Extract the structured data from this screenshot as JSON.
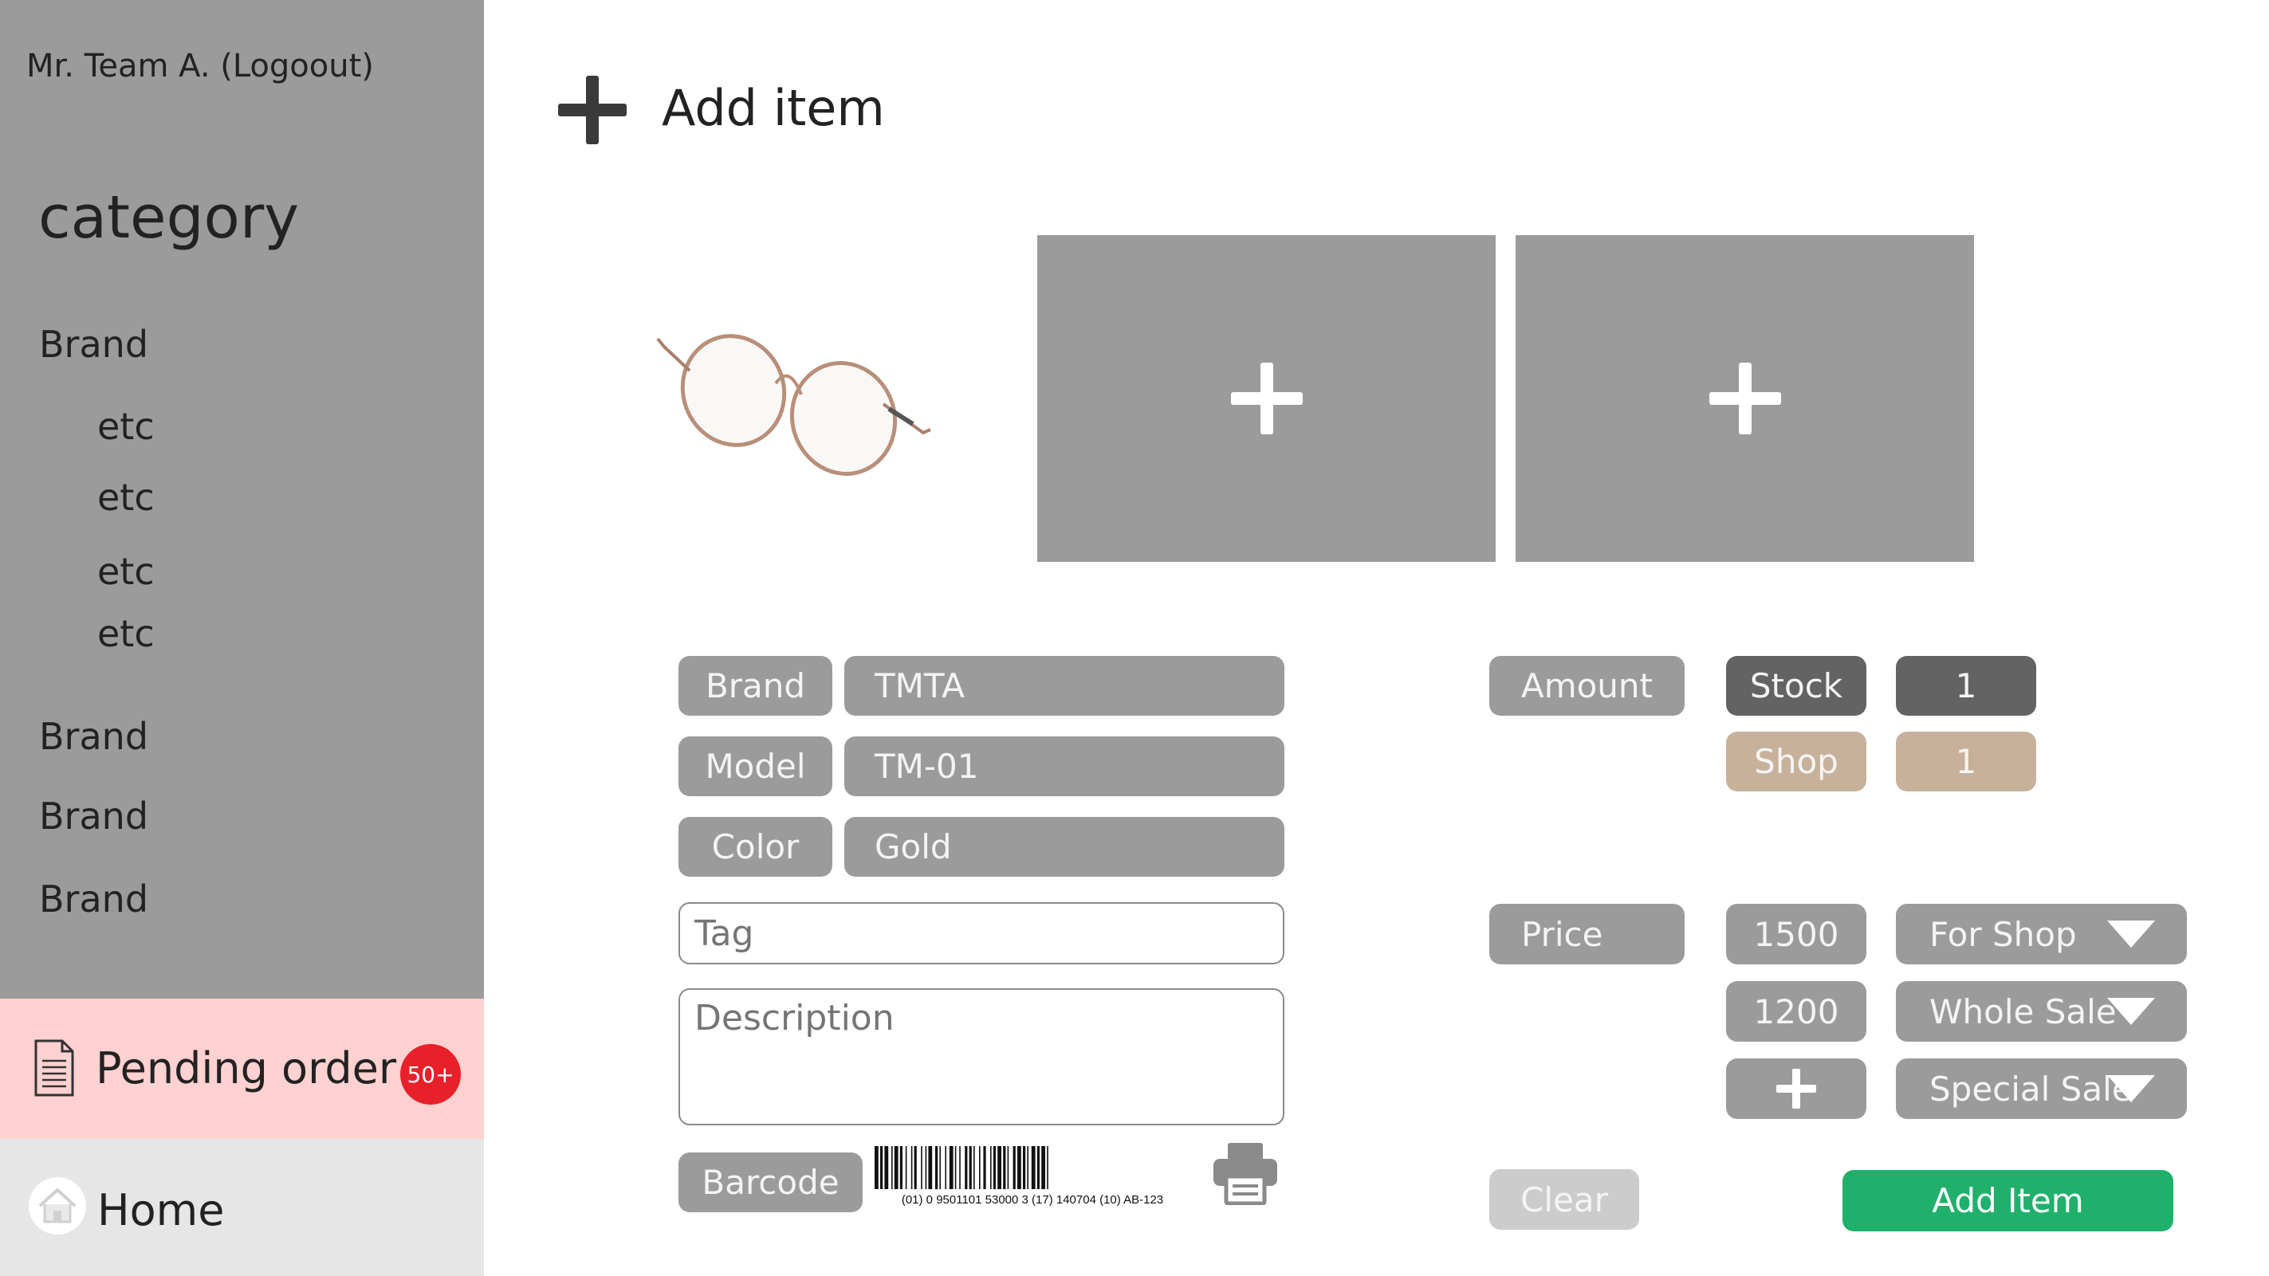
{
  "sidebar": {
    "user_line": "Mr. Team A. (Logoout)",
    "category_title": "category",
    "brand_1": "Brand",
    "sub_items": [
      "etc",
      "etc",
      "etc",
      "etc"
    ],
    "brand_2": "Brand",
    "brand_3": "Brand",
    "brand_4": "Brand",
    "pending": {
      "label": "Pending order",
      "badge": "50+"
    },
    "home": {
      "label": "Home"
    }
  },
  "header": {
    "title": "Add item"
  },
  "form": {
    "brand": {
      "label": "Brand",
      "value": "TMTA"
    },
    "model": {
      "label": "Model",
      "value": "TM-01"
    },
    "color": {
      "label": "Color",
      "value": "Gold"
    },
    "tag": {
      "placeholder": "Tag"
    },
    "description": {
      "placeholder": "Description"
    },
    "barcode": {
      "label": "Barcode",
      "code_text": "(01) 0 9501101 53000 3 (17) 140704 (10) AB-123"
    }
  },
  "amount": {
    "label": "Amount",
    "stock": {
      "label": "Stock",
      "value": "1"
    },
    "shop": {
      "label": "Shop",
      "value": "1"
    }
  },
  "price": {
    "label": "Price",
    "rows": [
      {
        "value": "1500",
        "type": "For Shop"
      },
      {
        "value": "1200",
        "type": "Whole Sale"
      },
      {
        "value": "",
        "type": "Special Sale"
      }
    ]
  },
  "buttons": {
    "clear": "Clear",
    "add": "Add Item"
  },
  "colors": {
    "sidebar": "#9b9b9b",
    "pending_bg": "#ffd1d0",
    "badge": "#e8202a",
    "home_bg": "#e6e6e6",
    "pill_grey": "#9b9b9b",
    "pill_dark": "#636363",
    "pill_tan": "#c8b19a",
    "add_button": "#21b06c",
    "clear_button": "#cccccc"
  },
  "icons": [
    "plus-icon",
    "document-icon",
    "home-icon",
    "printer-icon",
    "chevron-down-icon",
    "barcode-icon"
  ]
}
